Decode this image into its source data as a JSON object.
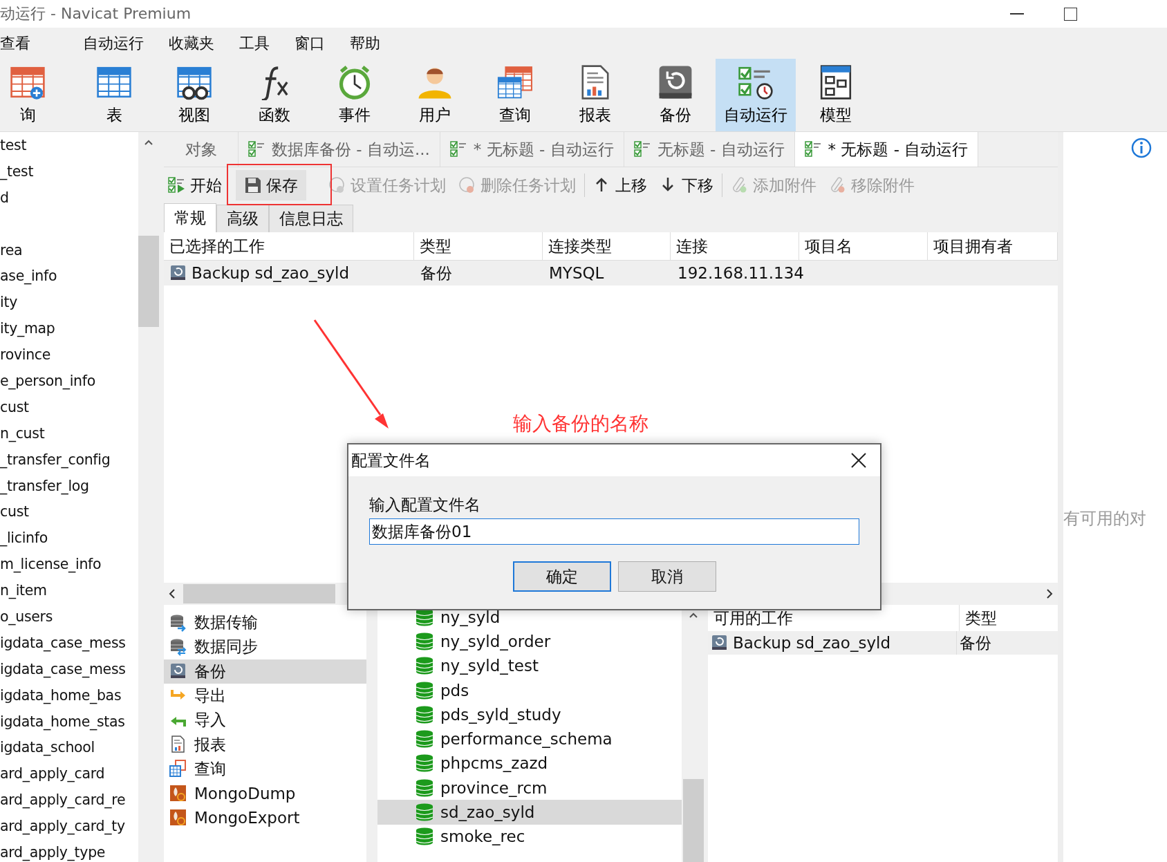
{
  "window": {
    "title": "动运行 - Navicat Premium"
  },
  "menu": [
    "查看",
    "自动运行",
    "收藏夹",
    "工具",
    "窗口",
    "帮助"
  ],
  "toolbar": [
    {
      "label": "询",
      "kind": "new-query",
      "selected": false
    },
    {
      "label": "表",
      "kind": "table",
      "selected": false
    },
    {
      "label": "视图",
      "kind": "view",
      "selected": false
    },
    {
      "label": "函数",
      "kind": "function",
      "selected": false
    },
    {
      "label": "事件",
      "kind": "event",
      "selected": false
    },
    {
      "label": "用户",
      "kind": "user",
      "selected": false
    },
    {
      "label": "查询",
      "kind": "query",
      "selected": false
    },
    {
      "label": "报表",
      "kind": "report",
      "selected": false
    },
    {
      "label": "备份",
      "kind": "backup",
      "selected": false
    },
    {
      "label": "自动运行",
      "kind": "automation",
      "selected": true
    },
    {
      "label": "模型",
      "kind": "model",
      "selected": false
    }
  ],
  "navigator": {
    "items": [
      "test",
      "_test",
      "d",
      "rea",
      "ase_info",
      "ity",
      "ity_map",
      "rovince",
      "e_person_info",
      "cust",
      "n_cust",
      "_transfer_config",
      "_transfer_log",
      "cust",
      "_licinfo",
      "m_license_info",
      "n_item",
      "o_users",
      "igdata_case_mess",
      "igdata_case_mess",
      "igdata_home_bas",
      "igdata_home_stas",
      "igdata_school",
      "ard_apply_card",
      "ard_apply_card_re",
      "ard_apply_card_ty",
      "ard_apply_type"
    ]
  },
  "tabs": [
    {
      "label": "对象",
      "kind": "object",
      "selected": false
    },
    {
      "label": "数据库备份 - 自动运...",
      "kind": "job",
      "selected": false
    },
    {
      "label": "* 无标题 - 自动运行",
      "kind": "job",
      "selected": false
    },
    {
      "label": "无标题 - 自动运行",
      "kind": "job",
      "selected": false
    },
    {
      "label": "* 无标题 - 自动运行",
      "kind": "job",
      "selected": true
    }
  ],
  "actions": [
    {
      "label": "开始",
      "kind": "start",
      "disabled": false
    },
    {
      "label": "保存",
      "kind": "save",
      "disabled": false
    },
    {
      "label": "设置任务计划",
      "kind": "schedule",
      "disabled": true
    },
    {
      "label": "删除任务计划",
      "kind": "unschedule",
      "disabled": true
    },
    {
      "label": "上移",
      "kind": "up",
      "disabled": false
    },
    {
      "label": "下移",
      "kind": "down",
      "disabled": false
    },
    {
      "label": "添加附件",
      "kind": "attach",
      "disabled": true
    },
    {
      "label": "移除附件",
      "kind": "detach",
      "disabled": true
    }
  ],
  "subtabs": [
    {
      "label": "常规",
      "selected": true
    },
    {
      "label": "高级",
      "selected": false
    },
    {
      "label": "信息日志",
      "selected": false
    }
  ],
  "selected_jobs": {
    "columns": [
      "已选择的工作",
      "类型",
      "连接类型",
      "连接",
      "项目名",
      "项目拥有者"
    ],
    "rows": [
      {
        "job": "Backup sd_zao_syld",
        "type": "备份",
        "connection_type": "MYSQL",
        "connection": "192.168.11.134"
      }
    ]
  },
  "job_types": [
    {
      "label": "数据传输",
      "kind": "transfer",
      "selected": false
    },
    {
      "label": "数据同步",
      "kind": "sync",
      "selected": false
    },
    {
      "label": "备份",
      "kind": "backup",
      "selected": true
    },
    {
      "label": "导出",
      "kind": "export",
      "selected": false
    },
    {
      "label": "导入",
      "kind": "import",
      "selected": false
    },
    {
      "label": "报表",
      "kind": "report",
      "selected": false
    },
    {
      "label": "查询",
      "kind": "query",
      "selected": false
    },
    {
      "label": "MongoDump",
      "kind": "mongo",
      "selected": false
    },
    {
      "label": "MongoExport",
      "kind": "mongo",
      "selected": false
    }
  ],
  "databases": [
    {
      "name": "ny_syld",
      "selected": false
    },
    {
      "name": "ny_syld_order",
      "selected": false
    },
    {
      "name": "ny_syld_test",
      "selected": false
    },
    {
      "name": "pds",
      "selected": false
    },
    {
      "name": "pds_syld_study",
      "selected": false
    },
    {
      "name": "performance_schema",
      "selected": false
    },
    {
      "name": "phpcms_zazd",
      "selected": false
    },
    {
      "name": "province_rcm",
      "selected": false
    },
    {
      "name": "sd_zao_syld",
      "selected": true
    },
    {
      "name": "smoke_rec",
      "selected": false
    }
  ],
  "available_jobs": {
    "columns": [
      "可用的工作",
      "类型"
    ],
    "rows": [
      {
        "job": "Backup sd_zao_syld",
        "type": "备份"
      }
    ]
  },
  "empty_message": "有可用的对",
  "annotation": {
    "text": "输入备份的名称"
  },
  "dialog": {
    "title": "配置文件名",
    "label": "输入配置文件名",
    "value": "数据库备份01",
    "buttons": [
      {
        "label": "确定",
        "default": true
      },
      {
        "label": "取消",
        "default": false
      }
    ]
  }
}
